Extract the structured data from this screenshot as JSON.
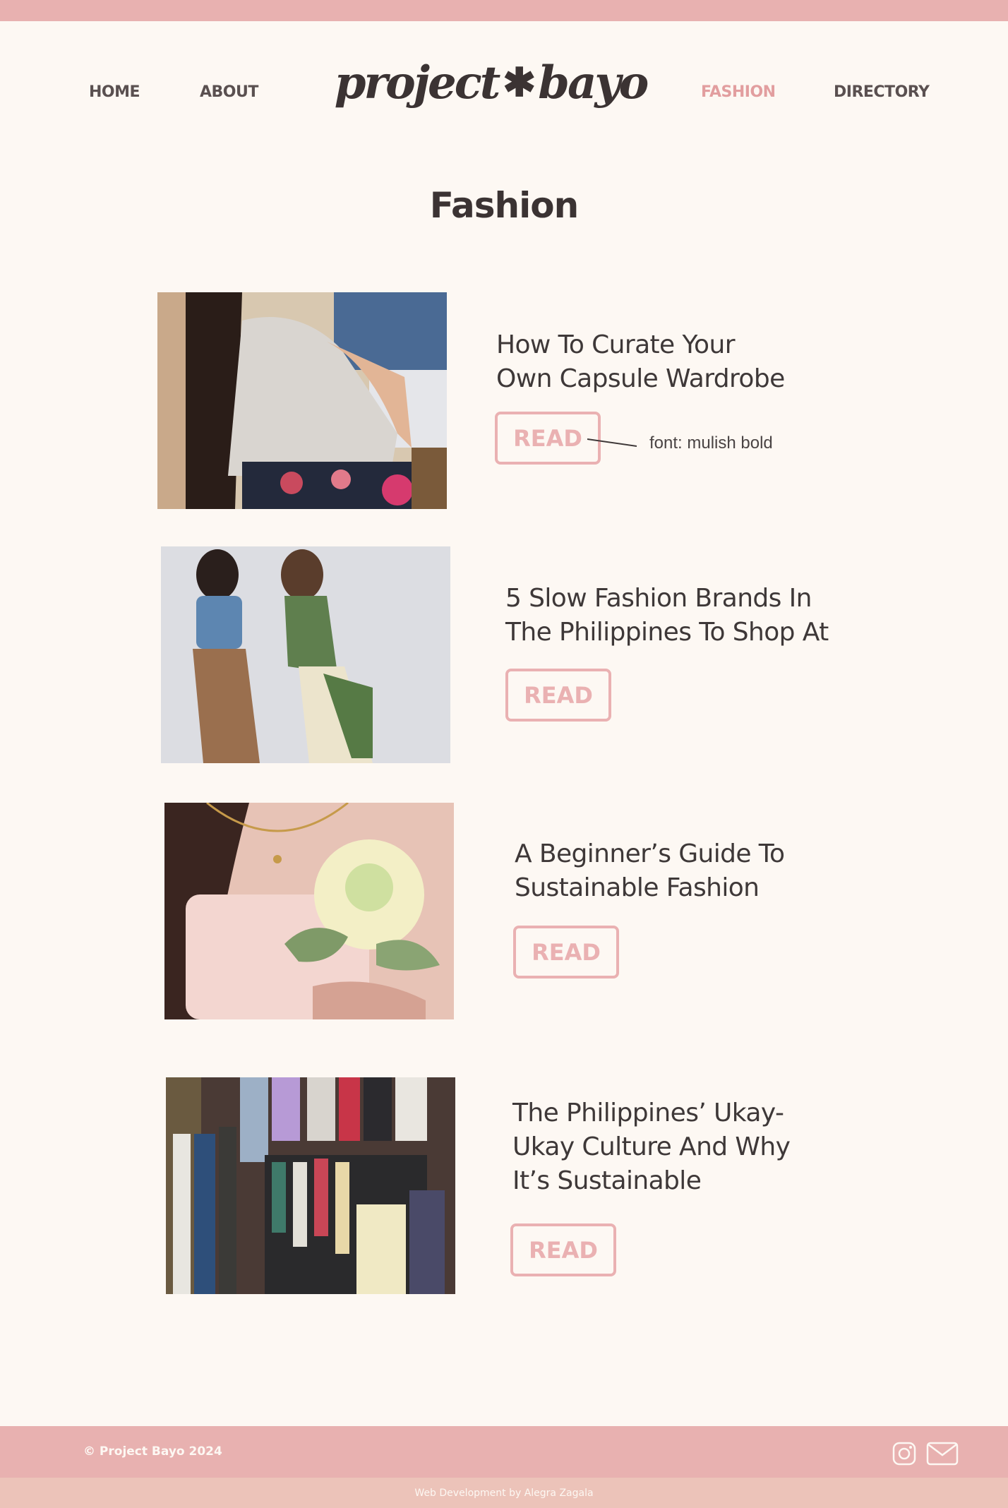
{
  "nav": {
    "home": "HOME",
    "about": "ABOUT",
    "logo_left": "project",
    "logo_star": "✱",
    "logo_right": "bayo",
    "fashion": "FASHION",
    "directory": "DIRECTORY"
  },
  "page": {
    "title": "Fashion"
  },
  "articles": [
    {
      "title_line1": "How To Curate Your",
      "title_line2": "Own Capsule Wardrobe",
      "read_label": "READ"
    },
    {
      "title_line1": "5 Slow Fashion Brands In",
      "title_line2": "The Philippines To Shop At",
      "read_label": "READ"
    },
    {
      "title_line1": "A Beginner’s Guide To",
      "title_line2": "Sustainable Fashion",
      "read_label": "READ"
    },
    {
      "title_line1": "The Philippines’ Ukay-",
      "title_line2": "Ukay Culture And Why",
      "title_line3": "It’s Sustainable",
      "read_label": "READ"
    }
  ],
  "annotation": {
    "text": "font: mulish bold"
  },
  "footer": {
    "copyright": "© Project Bayo 2024",
    "credit": "Web Development by Alegra Zagala",
    "icons": [
      "instagram-icon",
      "mail-icon"
    ]
  },
  "colors": {
    "background": "#fdf8f3",
    "accent_pink": "#e8b1b0",
    "button_pink": "#eab1b2",
    "active_nav": "#e29e9f",
    "text_dark": "#3e3838",
    "subfooter": "#ecc3b9"
  }
}
